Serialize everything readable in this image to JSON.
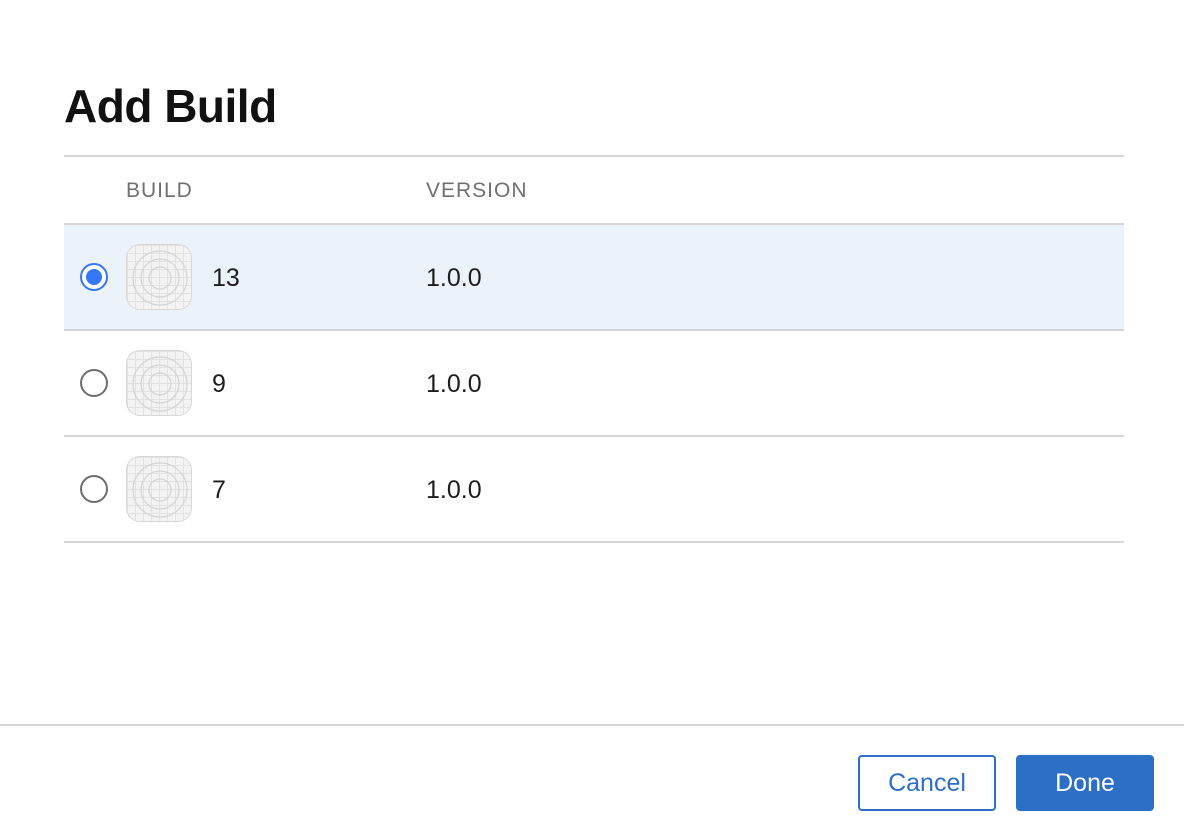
{
  "dialog": {
    "title": "Add Build"
  },
  "table": {
    "columns": [
      "BUILD",
      "VERSION"
    ],
    "rows": [
      {
        "build": "13",
        "version": "1.0.0",
        "selected": true,
        "icon": "app-placeholder-icon"
      },
      {
        "build": "9",
        "version": "1.0.0",
        "selected": false,
        "icon": "app-placeholder-icon"
      },
      {
        "build": "7",
        "version": "1.0.0",
        "selected": false,
        "icon": "app-placeholder-icon"
      }
    ]
  },
  "footer": {
    "cancel_label": "Cancel",
    "done_label": "Done"
  },
  "colors": {
    "accent": "#2d6fc7",
    "radio_selected": "#3478f6",
    "selected_row_bg": "#ebf2fa"
  }
}
